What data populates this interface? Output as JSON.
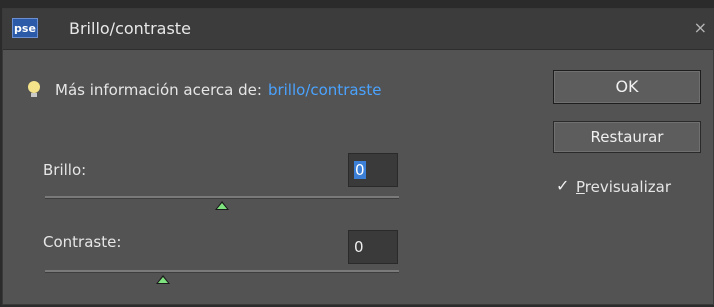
{
  "window": {
    "app_icon_text": "pse",
    "title": "Brillo/contraste",
    "close_symbol": "×"
  },
  "info": {
    "icon": "lightbulb-icon",
    "label": "Más información acerca de:",
    "link": "brillo/contraste"
  },
  "buttons": {
    "ok_label": "OK",
    "reset_label": "Restaurar"
  },
  "preview": {
    "checked": true,
    "label": "Previsualizar",
    "check_symbol": "✓"
  },
  "brightness": {
    "label": "Brillo:",
    "value": "0",
    "slider_value": 0,
    "slider_range": [
      -150,
      150
    ]
  },
  "contrast": {
    "label": "Contraste:",
    "value": "0",
    "slider_value": 0,
    "slider_range": [
      -50,
      100
    ]
  },
  "colors": {
    "dialog_bg": "#535353",
    "link": "#4aa3ff",
    "selection": "#3b7fd6",
    "thumb": "#7ee27e"
  }
}
